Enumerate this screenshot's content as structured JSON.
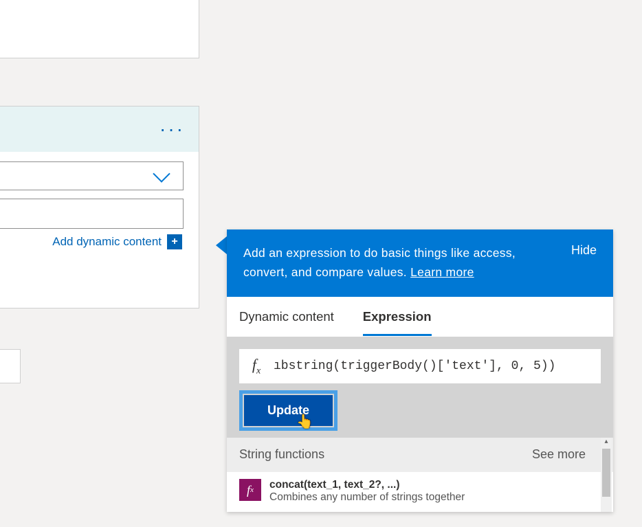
{
  "left_card": {
    "add_dynamic_label": "Add dynamic content",
    "add_icon_glyph": "+"
  },
  "expr": {
    "header_text_1": "Add an expression to do basic things like access,",
    "header_text_2": "convert, and compare values.",
    "learn_more": "Learn more",
    "hide": "Hide",
    "tabs": {
      "dynamic": "Dynamic content",
      "expression": "Expression"
    },
    "fx_value": "ıbstring(triggerBody()['text'], 0, 5))",
    "update": "Update",
    "string_functions": "String functions",
    "see_more": "See more",
    "concat_sig": "concat(text_1, text_2?, ...)",
    "concat_desc": "Combines any number of strings together"
  }
}
